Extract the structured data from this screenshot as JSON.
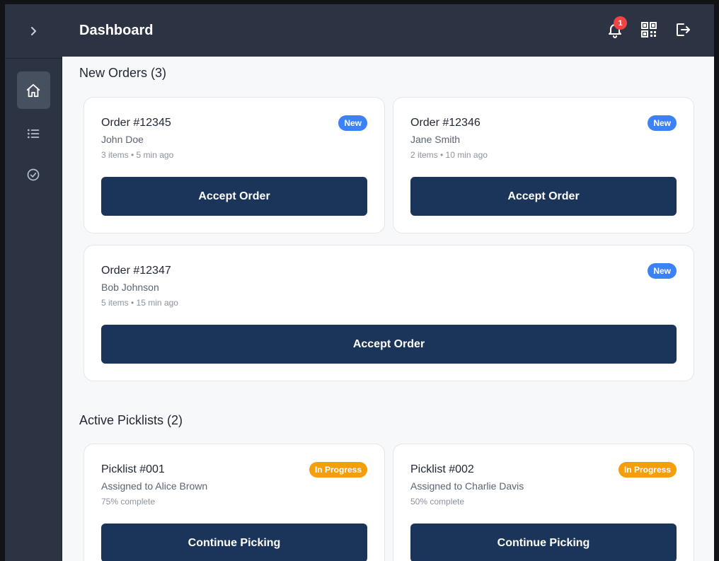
{
  "header": {
    "title": "Dashboard",
    "notification_count": "1"
  },
  "sidebar": {
    "items": [
      {
        "icon": "home-icon",
        "active": true
      },
      {
        "icon": "list-icon",
        "active": false
      },
      {
        "icon": "check-circle-icon",
        "active": false
      }
    ]
  },
  "new_orders": {
    "title": "New Orders (3)",
    "orders": [
      {
        "title": "Order #12345",
        "customer": "John Doe",
        "meta": "3 items • 5 min ago",
        "badge": "New",
        "button": "Accept Order"
      },
      {
        "title": "Order #12346",
        "customer": "Jane Smith",
        "meta": "2 items • 10 min ago",
        "badge": "New",
        "button": "Accept Order"
      },
      {
        "title": "Order #12347",
        "customer": "Bob Johnson",
        "meta": "5 items • 15 min ago",
        "badge": "New",
        "button": "Accept Order"
      }
    ]
  },
  "active_picklists": {
    "title": "Active Picklists (2)",
    "picklists": [
      {
        "title": "Picklist #001",
        "assignee": "Assigned to Alice Brown",
        "progress": "75% complete",
        "badge": "In Progress",
        "button": "Continue Picking"
      },
      {
        "title": "Picklist #002",
        "assignee": "Assigned to Charlie Davis",
        "progress": "50% complete",
        "badge": "In Progress",
        "button": "Continue Picking"
      }
    ]
  },
  "colors": {
    "header_bg": "#2c3444",
    "button_bg": "#1b355a",
    "badge_new": "#3b82f6",
    "badge_progress": "#f59e0b",
    "notification": "#ef4444"
  }
}
